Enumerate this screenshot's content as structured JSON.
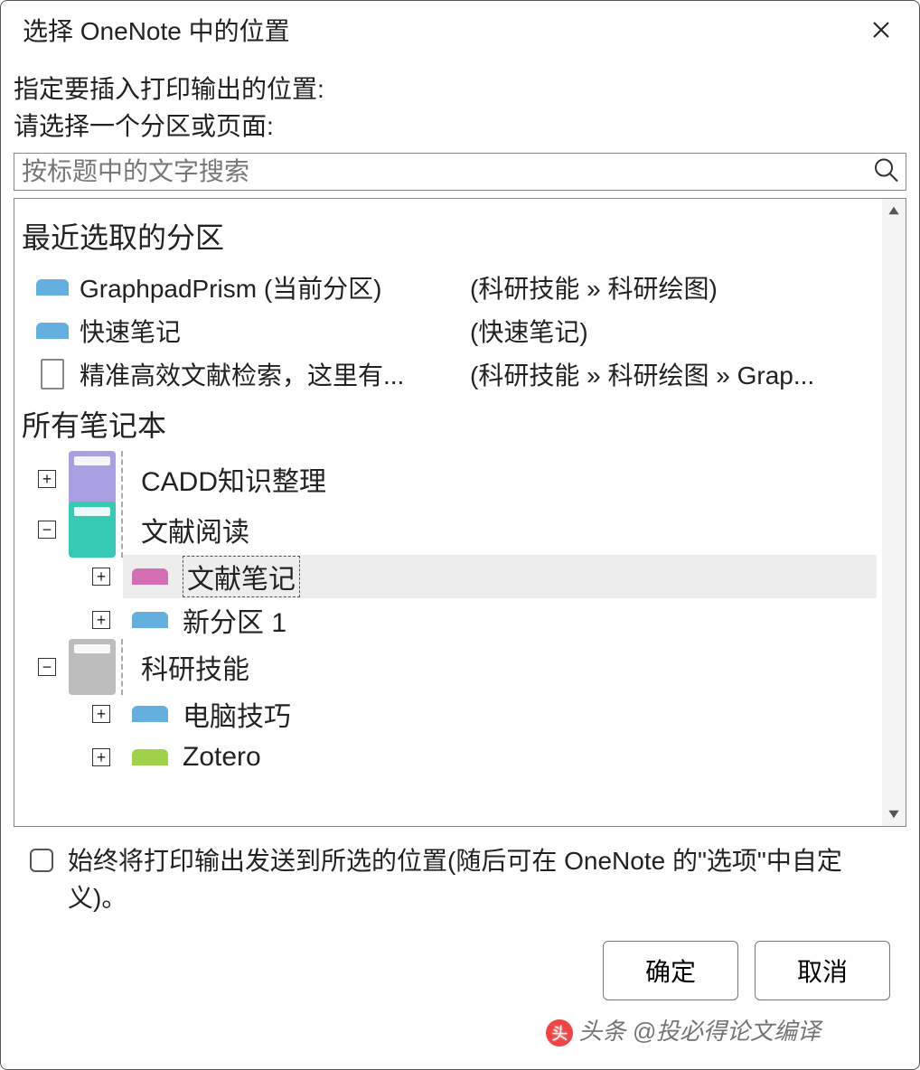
{
  "dialog": {
    "title": "选择 OneNote 中的位置",
    "instruction1": "指定要插入打印输出的位置:",
    "instruction2": "请选择一个分区或页面:"
  },
  "search": {
    "placeholder": "按标题中的文字搜索"
  },
  "recent": {
    "header": "最近选取的分区",
    "rows": [
      {
        "icon": "section",
        "color": "#63b0de",
        "name": "GraphpadPrism (当前分区)",
        "path": "(科研技能 » 科研绘图)"
      },
      {
        "icon": "section",
        "color": "#63b0de",
        "name": "快速笔记",
        "path": "(快速笔记)"
      },
      {
        "icon": "page",
        "color": "",
        "name": "精准高效文献检索，这里有...",
        "path": "(科研技能 » 科研绘图 » Grap..."
      }
    ]
  },
  "notebooks": {
    "header": "所有笔记本",
    "items": [
      {
        "exp": "plus",
        "color": "#a9a0e3",
        "label": "CADD知识整理",
        "children": []
      },
      {
        "exp": "minus",
        "color": "#36c9b3",
        "label": "文献阅读",
        "children": [
          {
            "exp": "plus",
            "color": "#d46fb3",
            "label": "文献笔记",
            "selected": true
          },
          {
            "exp": "plus",
            "color": "#63b0de",
            "label": "新分区 1",
            "selected": false
          }
        ]
      },
      {
        "exp": "minus",
        "color": "#bdbdbd",
        "label": "科研技能",
        "children": [
          {
            "exp": "plus",
            "color": "#63b0de",
            "label": "电脑技巧",
            "selected": false
          },
          {
            "exp": "plus",
            "color": "#9fd24a",
            "label": "Zotero",
            "selected": false
          }
        ]
      }
    ]
  },
  "checkbox": {
    "label": "始终将打印输出发送到所选的位置(随后可在 OneNote 的\"选项\"中自定义)。"
  },
  "buttons": {
    "ok": "确定",
    "cancel": "取消"
  },
  "watermark": "头条 @投必得论文编译"
}
